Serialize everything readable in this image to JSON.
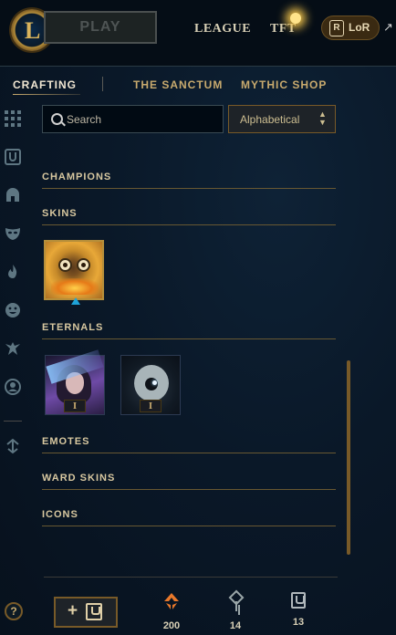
{
  "topbar": {
    "logo_letter": "L",
    "play_label": "PLAY",
    "nav": [
      "LEAGUE",
      "TFT"
    ],
    "lor_label": "LoR",
    "lor_r": "R",
    "external_glyph": "↗"
  },
  "tabs": {
    "active": "CRAFTING",
    "items": [
      "THE SANCTUM",
      "MYTHIC SHOP"
    ]
  },
  "sidebar": {
    "icons": [
      "grid-icon",
      "chest-icon",
      "helmet-icon",
      "mask-icon",
      "flame-icon",
      "emote-icon",
      "ward-icon",
      "profile-icon",
      "arrows-icon"
    ]
  },
  "search": {
    "placeholder": "Search",
    "value": ""
  },
  "sort": {
    "selected": "Alphabetical",
    "chevron": "⌃\n⌄"
  },
  "sections": {
    "champions": "CHAMPIONS",
    "skins": "SKINS",
    "eternals": "ETERNALS",
    "emotes": "EMOTES",
    "ward_skins": "WARD SKINS",
    "icons": "ICONS"
  },
  "eternals": [
    {
      "tier": "I"
    },
    {
      "tier": "I"
    }
  ],
  "colors": {
    "gold": "#c8aa6e",
    "accent_blue": "#1fa3d8",
    "essence_orange": "#e8782a"
  },
  "bottom": {
    "help_label": "?",
    "add_plus": "+",
    "currencies": [
      {
        "icon": "orange-essence-icon",
        "count": "200"
      },
      {
        "icon": "key-fragment-icon",
        "count": "14"
      },
      {
        "icon": "chest-icon",
        "count": "13"
      }
    ]
  }
}
